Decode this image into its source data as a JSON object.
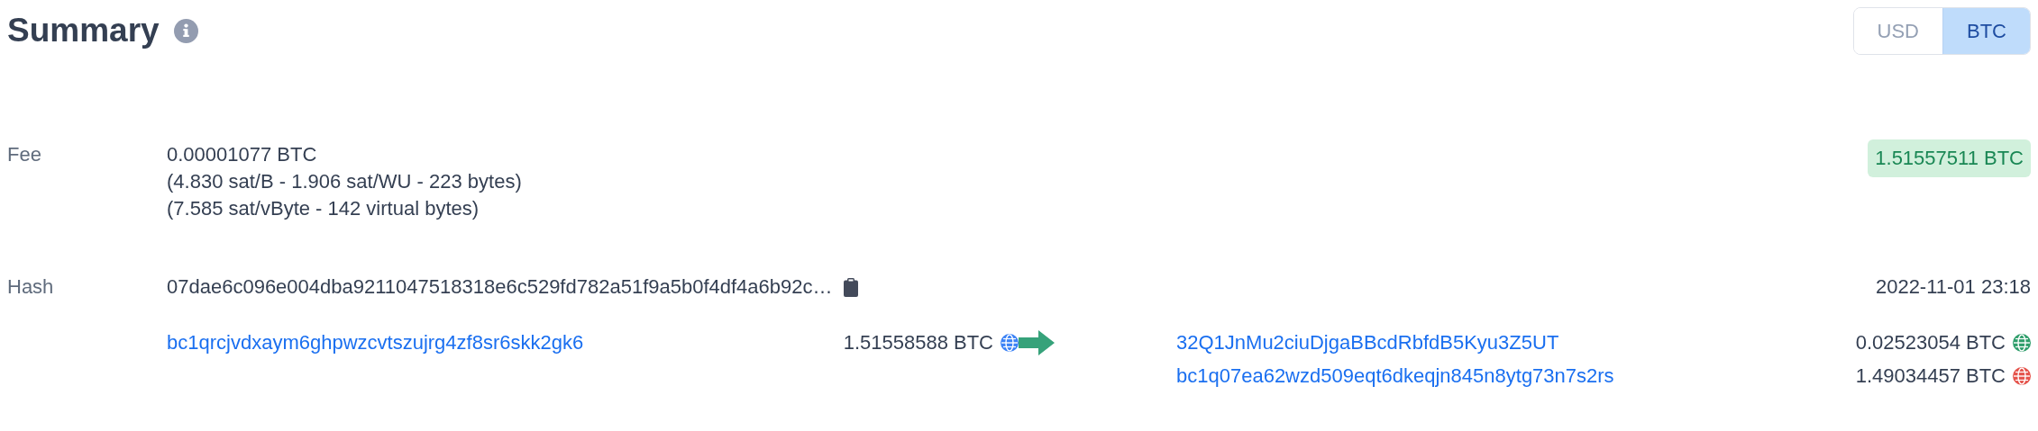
{
  "title": "Summary",
  "currency_toggle": [
    {
      "label": "USD",
      "selected": false
    },
    {
      "label": "BTC",
      "selected": true
    }
  ],
  "fee": {
    "label": "Fee",
    "lines": [
      "0.00001077 BTC",
      "(4.830 sat/B - 1.906 sat/WU - 223 bytes)",
      "(7.585 sat/vByte - 142 virtual bytes)"
    ],
    "total": "1.51557511 BTC"
  },
  "hash": {
    "label": "Hash",
    "value": "07dae6c096e004dba9211047518318e6c529fd782a51f9a5b0f4df4a6b92c…",
    "time": "2022-11-01 23:18"
  },
  "inputs": [
    {
      "address": "bc1qrcjvdxaym6ghpwzcvtszujrg4zf8sr6skk2gk6",
      "amount": "1.51558588 BTC",
      "color": "#3b82f6"
    }
  ],
  "outputs": [
    {
      "address": "32Q1JnMu2ciuDjgaBBcdRbfdB5Kyu3Z5UT",
      "amount": "0.02523054 BTC",
      "color": "#2f9e6b"
    },
    {
      "address": "bc1q07ea62wzd509eqt6dkeqjn845n8ytg73n7s2rs",
      "amount": "1.49034457 BTC",
      "color": "#e5534b"
    }
  ]
}
